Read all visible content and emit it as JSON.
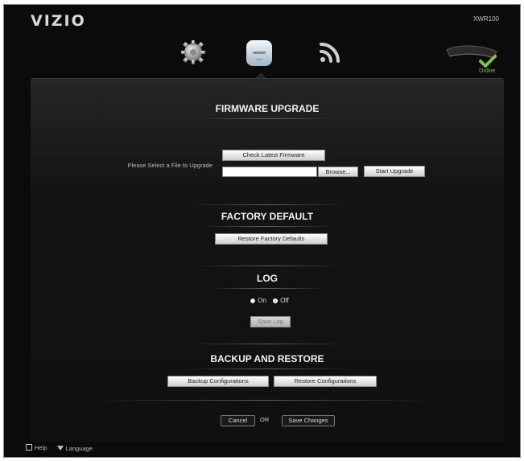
{
  "header": {
    "brand": "VIZIO",
    "model": "XWR100"
  },
  "nav": {
    "items": [
      {
        "icon": "gear-icon"
      },
      {
        "icon": "router-icon",
        "active": true
      },
      {
        "icon": "wireless-icon"
      }
    ]
  },
  "device_status": {
    "label": "Online",
    "color": "#7cc241"
  },
  "firmware": {
    "title": "FIRMWARE UPGRADE",
    "check_label": "Check Latest Firmware",
    "select_file_label": "Please Select a File to Upgrade",
    "file_value": "",
    "browse_label": "Browse...",
    "start_label": "Start Upgrade"
  },
  "factory": {
    "title": "FACTORY DEFAULT",
    "restore_label": "Restore Factory Defaults"
  },
  "log": {
    "title": "LOG",
    "on_label": "On",
    "off_label": "Off",
    "selected": "On",
    "save_label": "Save Log"
  },
  "backup": {
    "title": "BACKUP AND RESTORE",
    "backup_label": "Backup Configurations",
    "restore_label": "Restore Configurations"
  },
  "actions": {
    "cancel_label": "Cancel",
    "or_label": "OR",
    "save_label": "Save Changes"
  },
  "footer": {
    "help_label": "Help",
    "language_label": "Language"
  }
}
